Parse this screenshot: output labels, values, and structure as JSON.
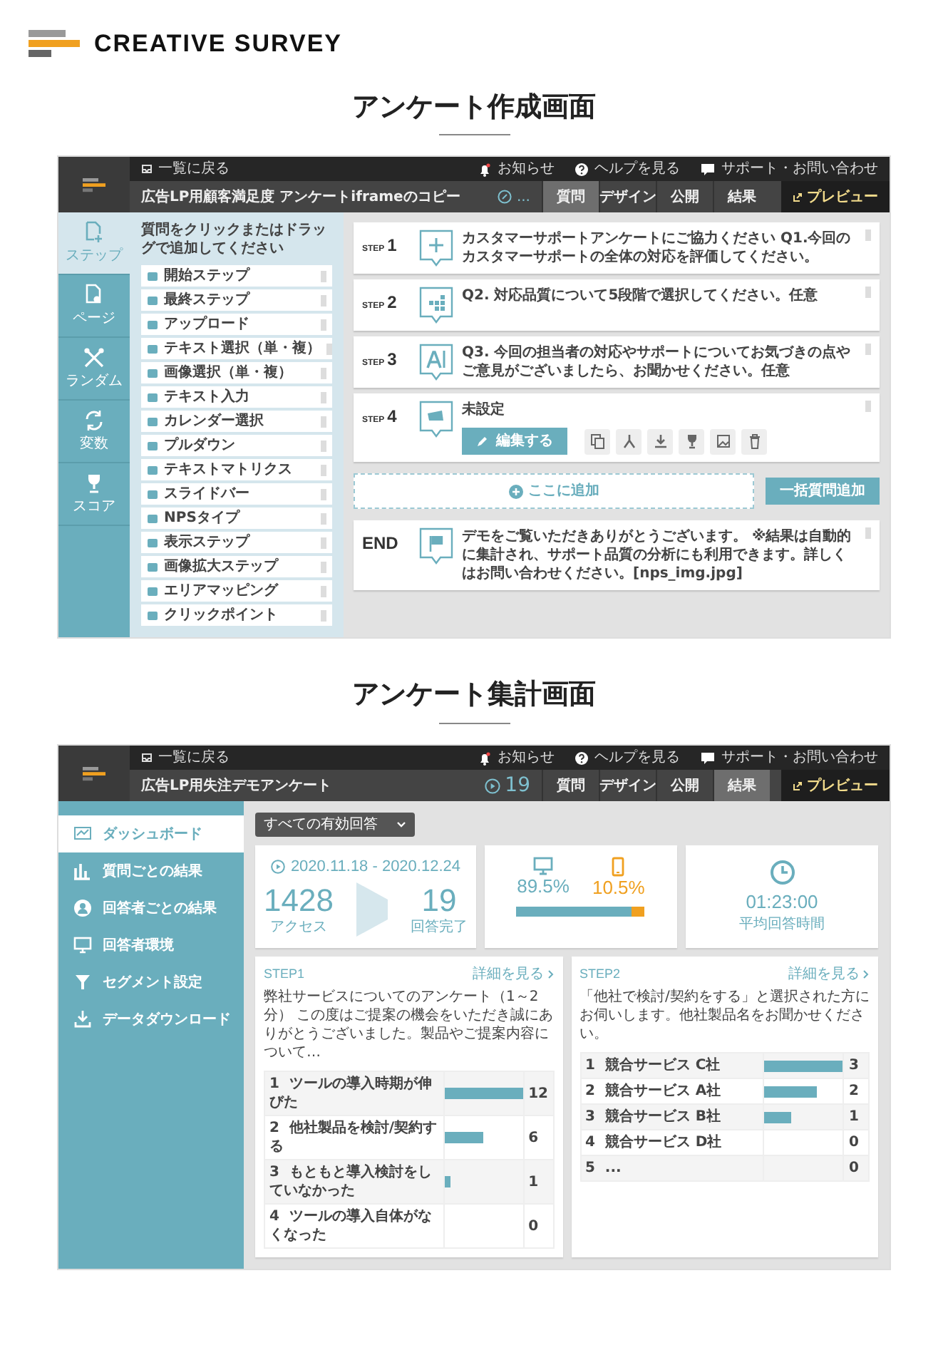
{
  "brand": {
    "name": "CREATIVE SURVEY"
  },
  "editor": {
    "heading": "アンケート作成画面",
    "top_bar": {
      "back_link": "一覧に戻る",
      "links": [
        {
          "kind": "notice",
          "label": "お知らせ"
        },
        {
          "kind": "help",
          "label": "ヘルプを見る"
        },
        {
          "kind": "support",
          "label": "サポート・お問い合わせ"
        }
      ]
    },
    "title_bar": {
      "survey_title": "広告LP用顧客満足度 アンケートiframeのコピー",
      "status": "...",
      "tabs": [
        {
          "label": "質問",
          "selected": true
        },
        {
          "label": "デザイン",
          "selected": false
        },
        {
          "label": "公開",
          "selected": false
        },
        {
          "label": "結果",
          "selected": false
        }
      ],
      "preview_button": "プレビュー"
    },
    "rail": [
      {
        "kind": "step",
        "label": "ステップ",
        "selected": true
      },
      {
        "kind": "page",
        "label": "ページ",
        "selected": false
      },
      {
        "kind": "random",
        "label": "ランダム",
        "selected": false
      },
      {
        "kind": "variable",
        "label": "変数",
        "selected": false
      },
      {
        "kind": "score",
        "label": "スコア",
        "selected": false
      }
    ],
    "palette": {
      "hint": "質問をクリックまたはドラッグで追加してください",
      "items": [
        "開始ステップ",
        "最終ステップ",
        "アップロード",
        "テキスト選択（単・複）",
        "画像選択（単・複）",
        "テキスト入力",
        "カレンダー選択",
        "プルダウン",
        "テキストマトリクス",
        "スライドバー",
        "NPSタイプ",
        "表示ステップ",
        "画像拡大ステップ",
        "エリアマッピング",
        "クリックポイント"
      ]
    },
    "steps": [
      {
        "step_label": "STEP",
        "number": "1",
        "kind": "slider",
        "text": "カスタマーサポートアンケートにご協力ください Q1.今回のカスタマーサポートの全体の対応を評価してください。",
        "expanded": false
      },
      {
        "step_label": "STEP",
        "number": "2",
        "kind": "grid",
        "text": "Q2. 対応品質について5段階で選択してください。任意",
        "expanded": false
      },
      {
        "step_label": "STEP",
        "number": "3",
        "kind": "text",
        "text": "Q3. 今回の担当者の対応やサポートについてお気づきの点やご意見がございましたら、お聞かせください。任意",
        "expanded": false
      },
      {
        "step_label": "STEP",
        "number": "4",
        "kind": "image",
        "text": "未設定",
        "expanded": true,
        "edit_button": "編集する"
      }
    ],
    "add_zone": "ここに追加",
    "bulk_add_button": "一括質問追加",
    "end": {
      "label": "END",
      "text": "デモをご覧いただきありがとうございます。 ※結果は自動的に集計され、サポート品質の分析にも利用できます。詳しくはお問い合わせください。[nps_img.jpg]"
    }
  },
  "results": {
    "heading": "アンケート集計画面",
    "top_bar": {
      "back_link": "一覧に戻る",
      "links": [
        {
          "kind": "notice",
          "label": "お知らせ"
        },
        {
          "kind": "help",
          "label": "ヘルプを見る"
        },
        {
          "kind": "support",
          "label": "サポート・お問い合わせ"
        }
      ]
    },
    "title_bar": {
      "survey_title": "広告LP用失注デモアンケート",
      "response_count": "19",
      "tabs": [
        {
          "label": "質問",
          "selected": false
        },
        {
          "label": "デザイン",
          "selected": false
        },
        {
          "label": "公開",
          "selected": false
        },
        {
          "label": "結果",
          "selected": true
        }
      ],
      "preview_button": "プレビュー"
    },
    "sidebar": [
      {
        "kind": "dashboard",
        "label": "ダッシュボード",
        "selected": true
      },
      {
        "kind": "per_question",
        "label": "質問ごとの結果",
        "selected": false
      },
      {
        "kind": "per_respondent",
        "label": "回答者ごとの結果",
        "selected": false
      },
      {
        "kind": "environment",
        "label": "回答者環境",
        "selected": false
      },
      {
        "kind": "segment",
        "label": "セグメント設定",
        "selected": false
      },
      {
        "kind": "download",
        "label": "データダウンロード",
        "selected": false
      }
    ],
    "filter_dropdown": "すべての有効回答",
    "period": {
      "range": "2020.11.18 - 2020.12.24",
      "access_count": "1428",
      "access_label": "アクセス",
      "complete_count": "19",
      "complete_label": "回答完了"
    },
    "devices": {
      "desktop_share": "89.5%",
      "mobile_share": "10.5%",
      "level": 0.895
    },
    "time": {
      "value": "01:23:00",
      "label": "平均回答時間"
    },
    "question_cards": [
      {
        "step": "STEP1",
        "detail_link": "詳細を見る",
        "question": "弊社サービスについてのアンケート（1～2分） この度はご提案の機会をいただき誠にありがとうございました。製品やご提案内容について…",
        "rows": [
          {
            "index": "1",
            "label": "ツールの導入時期が伸びた",
            "count": "12",
            "level": 1
          },
          {
            "index": "2",
            "label": "他社製品を検討/契約する",
            "count": "6",
            "level": 0.5
          },
          {
            "index": "3",
            "label": "もともと導入検討をしていなかった",
            "count": "1",
            "level": 0.083
          },
          {
            "index": "4",
            "label": "ツールの導入自体がなくなった",
            "count": "0",
            "level": 0
          }
        ]
      },
      {
        "step": "STEP2",
        "detail_link": "詳細を見る",
        "question": "「他社で検討/契約をする」と選択された方にお伺いします。他社製品名をお聞かせください。",
        "rows": [
          {
            "index": "1",
            "label": "競合サービス C社",
            "count": "3",
            "level": 1
          },
          {
            "index": "2",
            "label": "競合サービス A社",
            "count": "2",
            "level": 0.667
          },
          {
            "index": "3",
            "label": "競合サービス B社",
            "count": "1",
            "level": 0.333
          },
          {
            "index": "4",
            "label": "競合サービス D社",
            "count": "0",
            "level": 0
          },
          {
            "index": "5",
            "label": "...",
            "count": "0",
            "level": 0
          }
        ]
      }
    ]
  }
}
